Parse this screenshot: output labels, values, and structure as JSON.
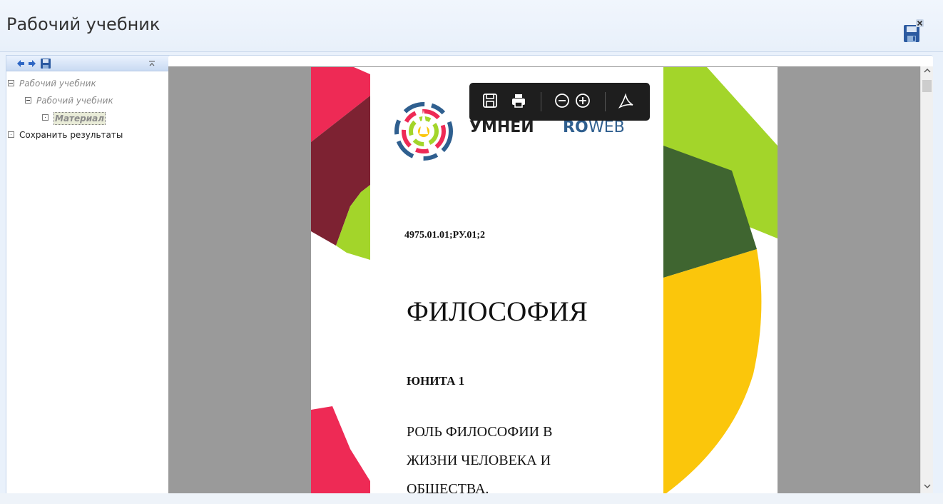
{
  "app": {
    "title": "Рабочий учебник"
  },
  "tree": {
    "items": [
      {
        "label": "Рабочий учебник"
      },
      {
        "label": "Рабочий учебник"
      },
      {
        "label": "Материал"
      },
      {
        "label": "Сохранить результаты"
      }
    ]
  },
  "pdf_toolbar": {
    "icons": [
      "save-icon",
      "print-icon",
      "zoom-out-icon",
      "zoom-in-icon",
      "acrobat-icon"
    ]
  },
  "document": {
    "logo_left": "УМНЕИ",
    "logo_right_a": "RO",
    "logo_right_b": "WEB",
    "code": "4975.01.01;РУ.01;2",
    "title": "ФИЛОСОФИЯ",
    "unit": "ЮНИТА 1",
    "lines": [
      "РОЛЬ ФИЛОСОФИИ В",
      "ЖИЗНИ ЧЕЛОВЕКА И",
      "ОБЩЕСТВА."
    ]
  },
  "colors": {
    "pink": "#ee2a55",
    "maroon": "#7d2232",
    "lime": "#a3d52a",
    "darkgreen": "#3f6530",
    "yellow": "#fbc60b",
    "blue": "#2f5f8f"
  }
}
